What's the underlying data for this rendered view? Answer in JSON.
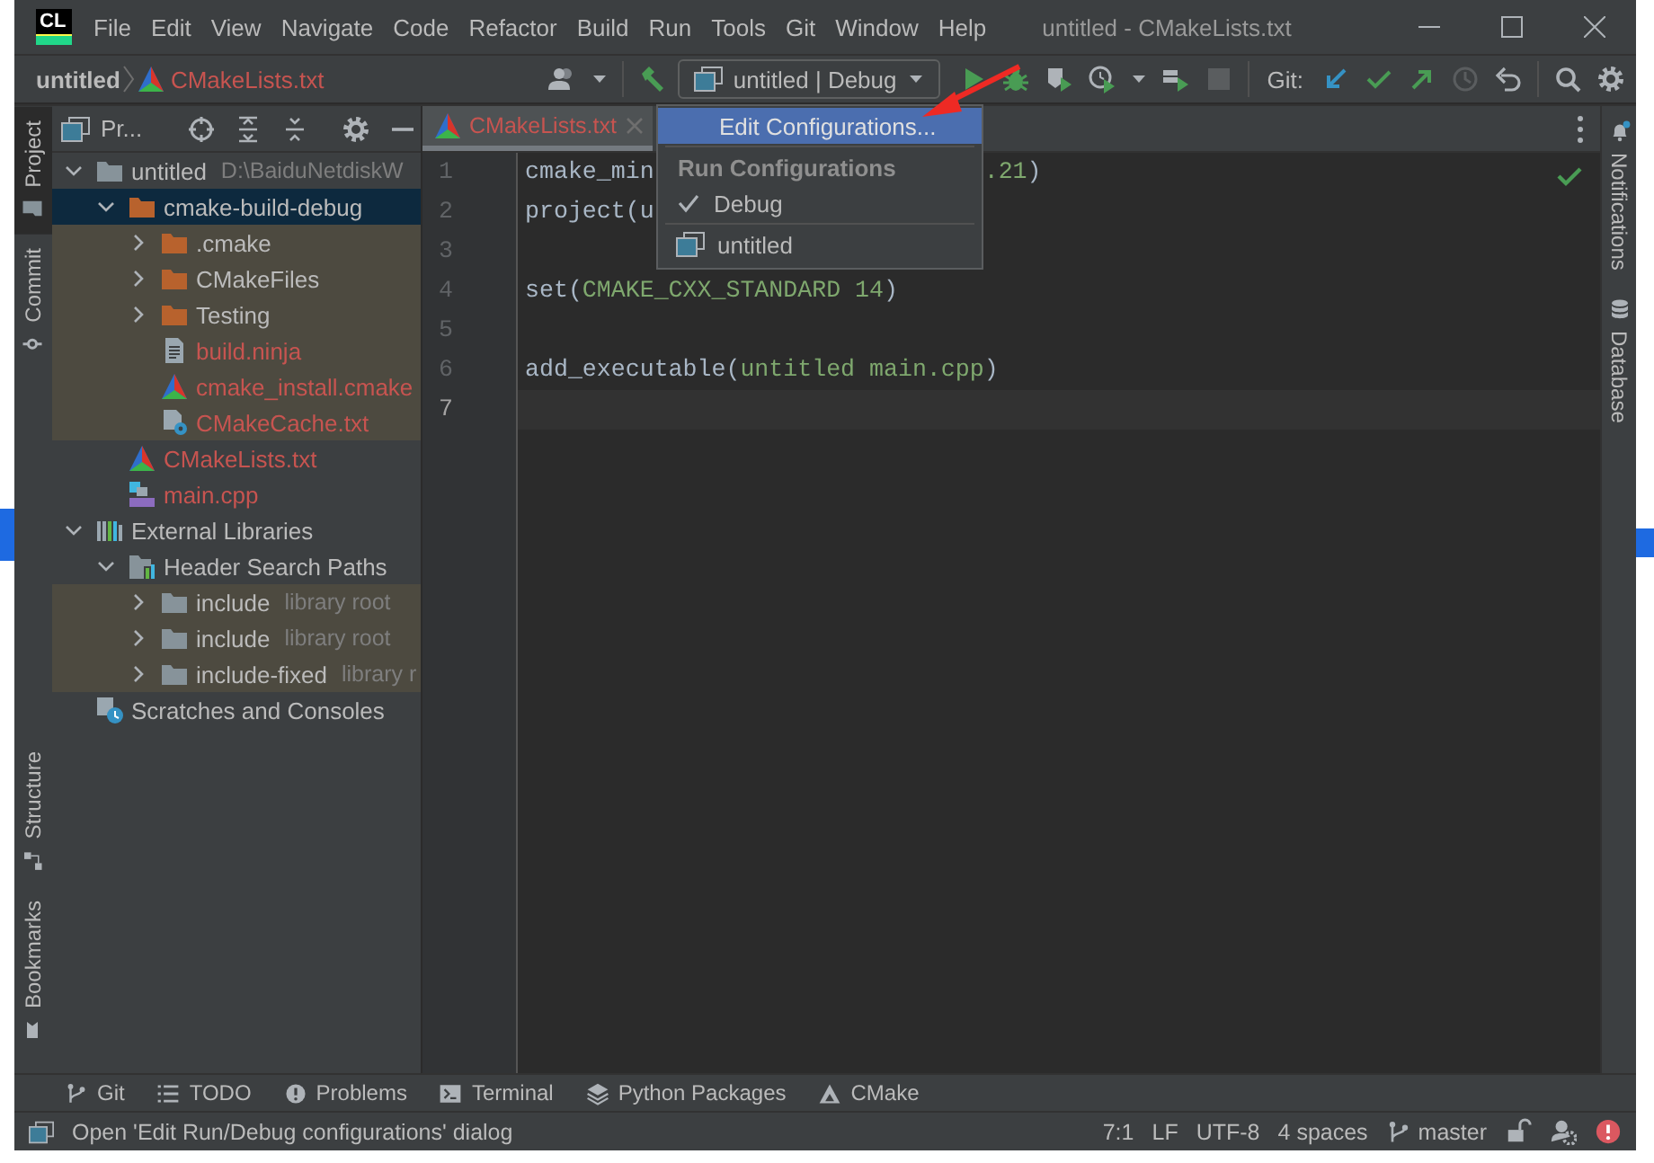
{
  "app_logo": "CL",
  "menu": [
    {
      "label": "File"
    },
    {
      "label": "Edit"
    },
    {
      "label": "View"
    },
    {
      "label": "Navigate"
    },
    {
      "label": "Code"
    },
    {
      "label": "Refactor"
    },
    {
      "label": "Build"
    },
    {
      "label": "Run"
    },
    {
      "label": "Tools"
    },
    {
      "label": "Git"
    },
    {
      "label": "Window"
    },
    {
      "label": "Help"
    }
  ],
  "window": {
    "title": "untitled - CMakeLists.txt"
  },
  "breadcrumb": [
    {
      "label": "untitled",
      "kind": "project"
    },
    {
      "label": "CMakeLists.txt",
      "kind": "cmake"
    }
  ],
  "run_config": {
    "label": "untitled | Debug"
  },
  "git_label": "Git:",
  "left_stripe": {
    "top": [
      {
        "label": "Project",
        "selected": true
      },
      {
        "label": "Commit",
        "selected": false
      }
    ],
    "bottom": [
      {
        "label": "Structure",
        "selected": false
      },
      {
        "label": "Bookmarks",
        "selected": false
      }
    ]
  },
  "project_panel": {
    "title": "Pr...",
    "tree": [
      {
        "label": "untitled",
        "kind": "folder",
        "expanded": true,
        "selected": false,
        "highlighted": false,
        "untracked": false,
        "hint": "D:\\BaiduNetdiskW",
        "children": [
          {
            "label": "cmake-build-debug",
            "kind": "excluded-folder",
            "expanded": true,
            "selected": true,
            "highlighted": false,
            "untracked": false,
            "children": [
              {
                "label": ".cmake",
                "kind": "excluded-folder",
                "expanded": false,
                "selected": false,
                "highlighted": true,
                "untracked": false
              },
              {
                "label": "CMakeFiles",
                "kind": "excluded-folder",
                "expanded": false,
                "selected": false,
                "highlighted": true,
                "untracked": false
              },
              {
                "label": "Testing",
                "kind": "excluded-folder",
                "expanded": false,
                "selected": false,
                "highlighted": true,
                "untracked": false
              },
              {
                "label": "build.ninja",
                "kind": "text-file",
                "selected": false,
                "highlighted": true,
                "untracked": true
              },
              {
                "label": "cmake_install.cmake",
                "kind": "cmake-file",
                "selected": false,
                "highlighted": true,
                "untracked": true
              },
              {
                "label": "CMakeCache.txt",
                "kind": "cache-file",
                "selected": false,
                "highlighted": true,
                "untracked": true
              }
            ]
          },
          {
            "label": "CMakeLists.txt",
            "kind": "cmake-file",
            "selected": false,
            "highlighted": false,
            "untracked": true
          },
          {
            "label": "main.cpp",
            "kind": "cpp-file",
            "selected": false,
            "highlighted": false,
            "untracked": true
          }
        ]
      },
      {
        "label": "External Libraries",
        "kind": "library",
        "expanded": true,
        "selected": false,
        "highlighted": false,
        "untracked": false,
        "children": [
          {
            "label": "Header Search Paths",
            "kind": "header-paths",
            "expanded": true,
            "selected": false,
            "highlighted": false,
            "untracked": false,
            "children": [
              {
                "label": "include",
                "kind": "folder",
                "expanded": false,
                "selected": false,
                "highlighted": true,
                "untracked": false,
                "hint": "library root"
              },
              {
                "label": "include",
                "kind": "folder",
                "expanded": false,
                "selected": false,
                "highlighted": true,
                "untracked": false,
                "hint": "library root"
              },
              {
                "label": "include-fixed",
                "kind": "folder",
                "expanded": false,
                "selected": false,
                "highlighted": true,
                "untracked": false,
                "hint": "library r"
              }
            ]
          }
        ]
      },
      {
        "label": "Scratches and Consoles",
        "kind": "scratches",
        "selected": false,
        "highlighted": false,
        "untracked": false
      }
    ]
  },
  "editor": {
    "tabs": [
      {
        "label": "CMakeLists.txt",
        "selected": true
      }
    ],
    "lines": [
      {
        "number": "1",
        "current": false,
        "segments": [
          {
            "text": "cmake_min",
            "kind": "plain"
          }
        ],
        "after_popup": [
          {
            "text": ".21",
            "kind": "arg"
          },
          {
            "text": ")",
            "kind": "plain"
          }
        ]
      },
      {
        "number": "2",
        "current": false,
        "segments": [
          {
            "text": "project(u",
            "kind": "plain"
          }
        ]
      },
      {
        "number": "3",
        "current": false
      },
      {
        "number": "4",
        "current": false,
        "segments": [
          {
            "text": "set(",
            "kind": "plain"
          },
          {
            "text": "CMAKE_CXX_STANDARD 14",
            "kind": "arg"
          },
          {
            "text": ")",
            "kind": "plain"
          }
        ]
      },
      {
        "number": "5",
        "current": false
      },
      {
        "number": "6",
        "current": false,
        "segments": [
          {
            "text": "add_executable(",
            "kind": "plain"
          },
          {
            "text": "untitled main.cpp",
            "kind": "arg"
          },
          {
            "text": ")",
            "kind": "plain"
          }
        ]
      },
      {
        "number": "7",
        "current": true
      }
    ]
  },
  "run_popup": {
    "items": [
      {
        "kind": "action",
        "label": "Edit Configurations...",
        "selected": true
      },
      {
        "kind": "header",
        "label": "Run Configurations",
        "selected": false
      },
      {
        "kind": "check",
        "label": "Debug",
        "checked": true,
        "selected": false
      },
      {
        "kind": "config",
        "label": "untitled",
        "selected": false
      }
    ]
  },
  "right_stripe": [
    {
      "label": "Notifications"
    },
    {
      "label": "Database"
    }
  ],
  "tool_windows": [
    {
      "label": "Git"
    },
    {
      "label": "TODO"
    },
    {
      "label": "Problems"
    },
    {
      "label": "Terminal"
    },
    {
      "label": "Python Packages"
    },
    {
      "label": "CMake"
    }
  ],
  "status_bar": {
    "message": "Open 'Edit Run/Debug configurations' dialog",
    "items": [
      "7:1",
      "LF",
      "UTF-8",
      "4 spaces"
    ],
    "branch": "master"
  }
}
